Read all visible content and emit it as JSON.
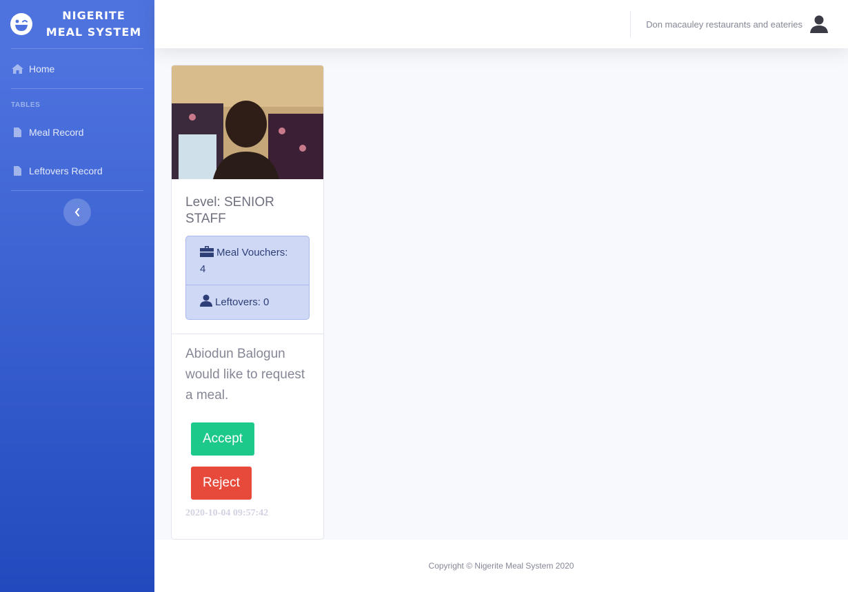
{
  "sidebar": {
    "brand": {
      "line1": "NIGERITE",
      "line2": "MEAL SYSTEM",
      "icon": "laughing-wink-icon"
    },
    "nav": {
      "home": {
        "label": "Home",
        "icon": "home-icon"
      },
      "heading": "TABLES",
      "meal_record": {
        "label": "Meal Record",
        "icon": "file-icon"
      },
      "leftovers_record": {
        "label": "Leftovers Record",
        "icon": "file-icon"
      }
    },
    "toggle_icon": "chevron-left-icon"
  },
  "topbar": {
    "user_name": "Don macauley restaurants and eateries",
    "user_icon": "user-icon"
  },
  "card": {
    "photo_icon": "profile-photo",
    "level": "Level: SENIOR STAFF",
    "meal_vouchers_label": "Meal Vouchers:",
    "meal_vouchers_value": "4",
    "leftovers_label": "Leftovers:",
    "leftovers_value": "0",
    "request_text": "Abiodun Balogun would like to request a meal.",
    "accept_label": "Accept",
    "reject_label": "Reject",
    "timestamp": "2020-10-04 09:57:42"
  },
  "footer": {
    "copyright": "Copyright © Nigerite Meal System 2020"
  },
  "colors": {
    "primary": "#4e73df",
    "success": "#1cc88a",
    "danger": "#e74a3b",
    "info_box": "#cfd8f5"
  }
}
